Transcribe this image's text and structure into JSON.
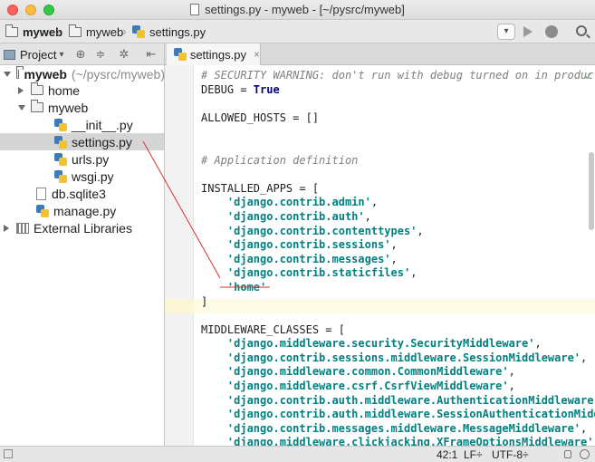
{
  "window": {
    "title": "settings.py - myweb - [~/pysrc/myweb]"
  },
  "navbar": {
    "crumbs": [
      "myweb",
      "myweb",
      "settings.py"
    ],
    "run_select": "▾"
  },
  "project_toolbar": {
    "view_label": "Project",
    "view_caret": "▾",
    "icons": [
      "target-icon",
      "collapse-icon",
      "gear-icon",
      "hide-icon"
    ]
  },
  "editor_tabs": [
    {
      "label": "settings.py",
      "close": "×"
    }
  ],
  "tree": {
    "root_label": "myweb",
    "root_path": "(~/pysrc/myweb)",
    "home": "home",
    "myweb": "myweb",
    "init": "__init__.py",
    "settings": "settings.py",
    "urls": "urls.py",
    "wsgi": "wsgi.py",
    "db": "db.sqlite3",
    "manage": "manage.py",
    "external": "External Libraries"
  },
  "code": {
    "l1": "# SECURITY WARNING: don't run with debug turned on in production!",
    "l2a": "DEBUG = ",
    "l2b": "True",
    "l4": "ALLOWED_HOSTS = []",
    "l7": "# Application definition",
    "l9": "INSTALLED_APPS = [",
    "apps": [
      "'django.contrib.admin'",
      "'django.contrib.auth'",
      "'django.contrib.contenttypes'",
      "'django.contrib.sessions'",
      "'django.contrib.messages'",
      "'django.contrib.staticfiles'",
      "'home'"
    ],
    "close": "]",
    "l19": "MIDDLEWARE_CLASSES = [",
    "middleware": [
      "'django.middleware.security.SecurityMiddleware'",
      "'django.contrib.sessions.middleware.SessionMiddleware'",
      "'django.middleware.common.CommonMiddleware'",
      "'django.middleware.csrf.CsrfViewMiddleware'",
      "'django.contrib.auth.middleware.AuthenticationMiddleware'",
      "'django.contrib.auth.middleware.SessionAuthenticationMiddleware'",
      "'django.contrib.messages.middleware.MessageMiddleware'",
      "'django.middleware.clickjacking.XFrameOptionsMiddleware'"
    ],
    "comma": ",",
    "check": "✓"
  },
  "status": {
    "position": "42:1",
    "line_sep": "LF÷",
    "encoding": "UTF-8÷"
  },
  "colors": {
    "annotation": "#d9302c",
    "string": "#008080",
    "keyword": "#000080"
  }
}
